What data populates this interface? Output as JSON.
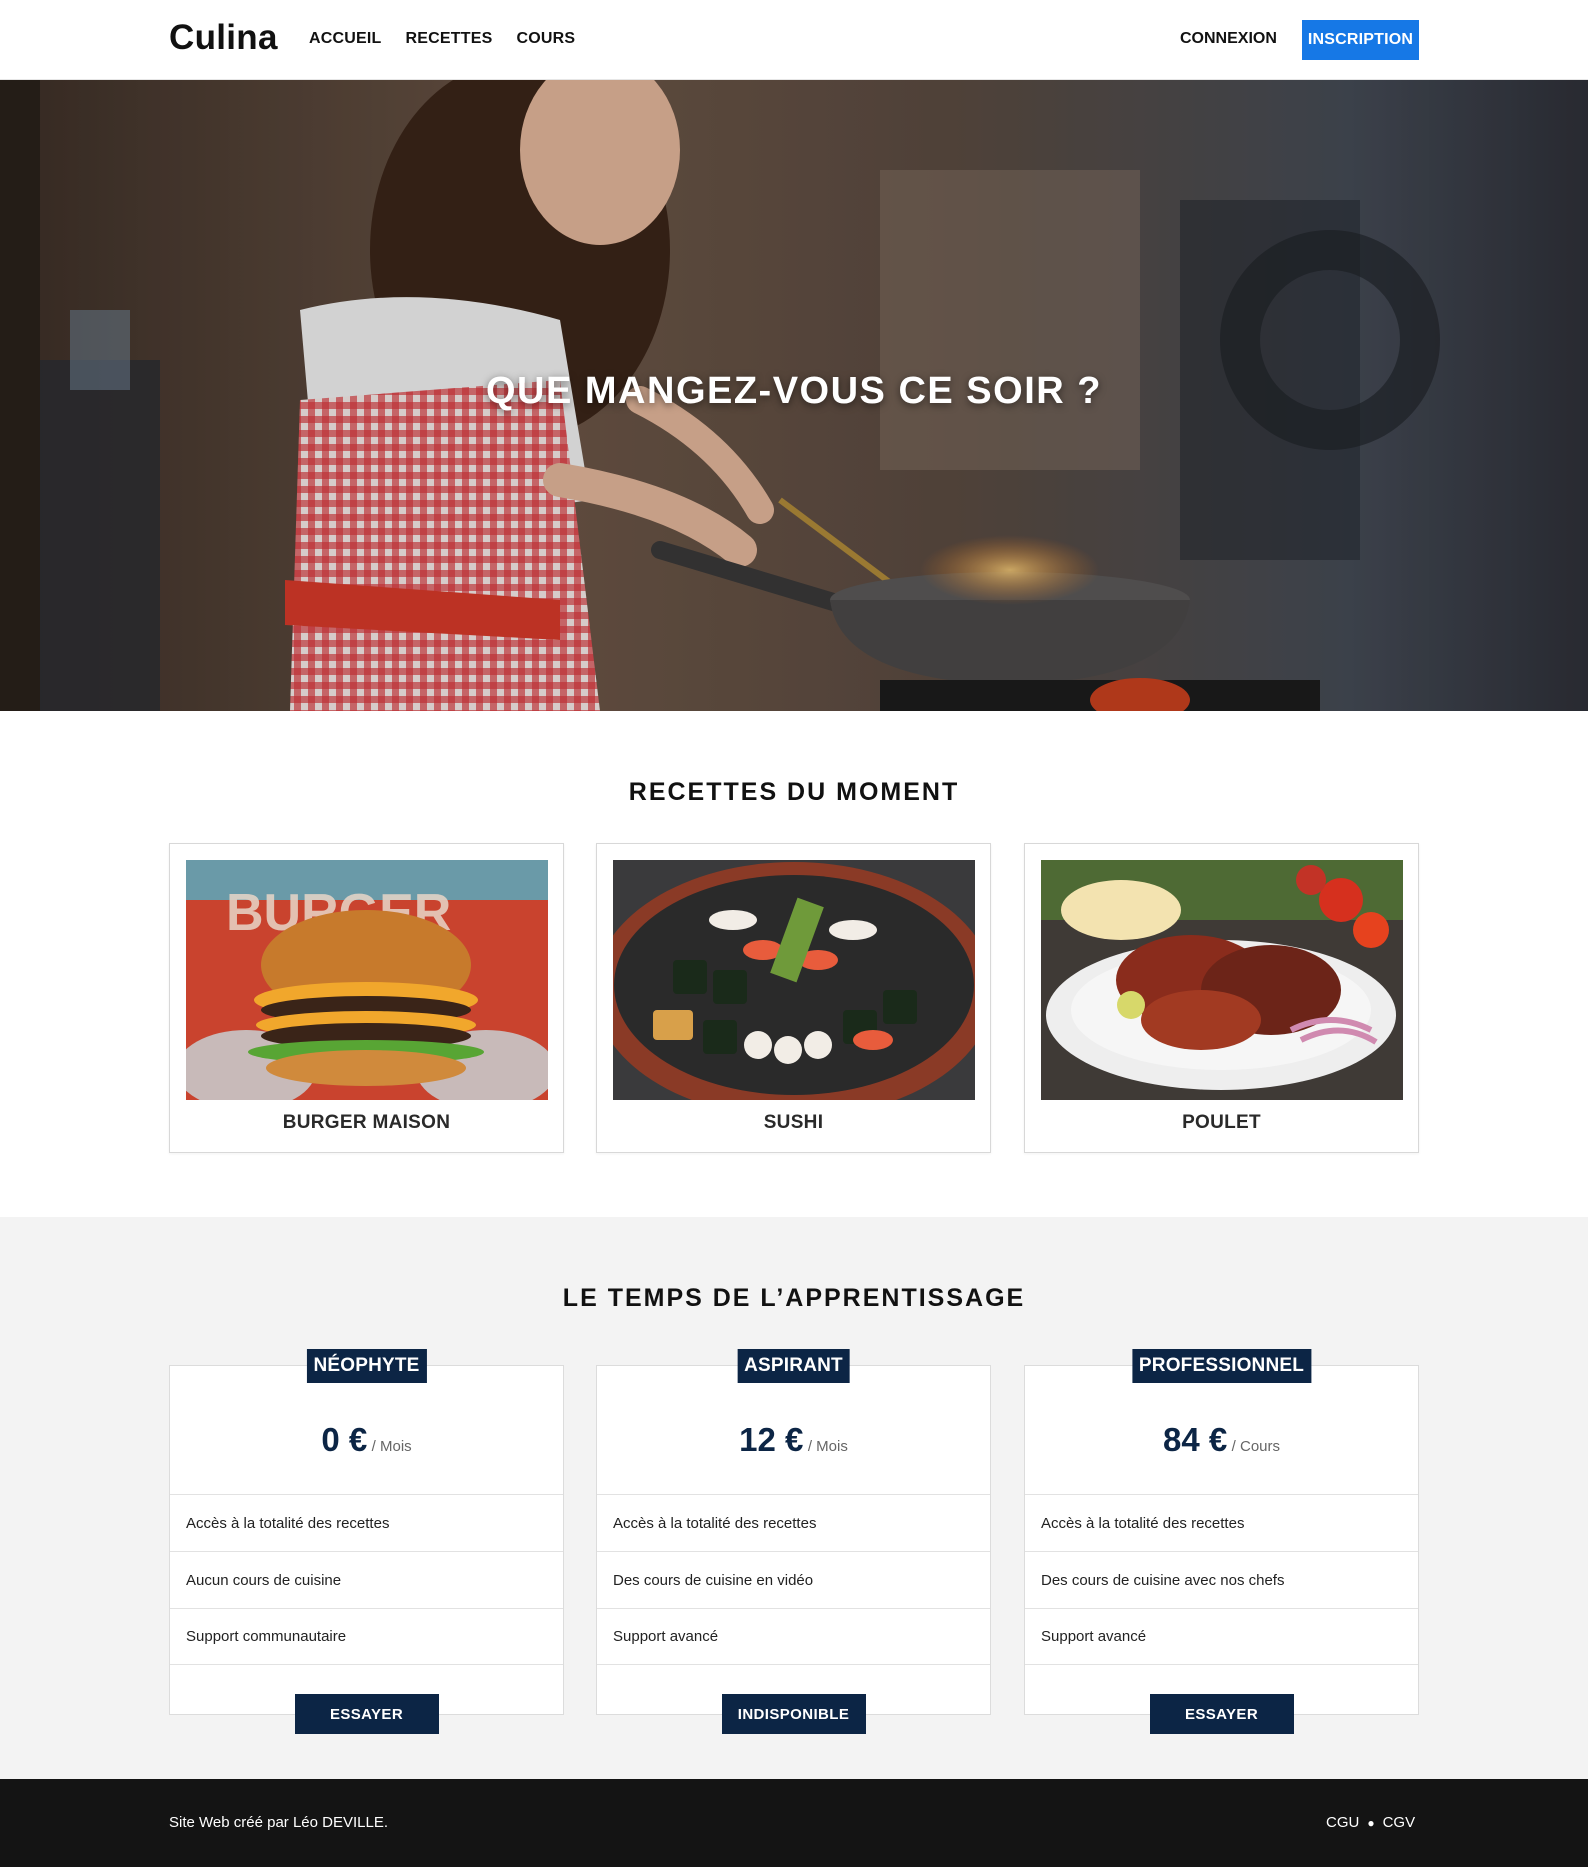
{
  "header": {
    "logo": "Culina",
    "nav": [
      "ACCUEIL",
      "RECETTES",
      "COURS"
    ],
    "login": "CONNEXION",
    "signup": "INSCRIPTION"
  },
  "hero": {
    "title": "QUE MANGEZ-VOUS CE SOIR ?"
  },
  "recipes": {
    "title": "RECETTES DU MOMENT",
    "items": [
      {
        "name": "BURGER MAISON"
      },
      {
        "name": "SUSHI"
      },
      {
        "name": "POULET"
      }
    ]
  },
  "pricing": {
    "title": "LE TEMPS DE L’APPRENTISSAGE",
    "plans": [
      {
        "badge": "NÉOPHYTE",
        "amount": "0 €",
        "period": "/ Mois",
        "features": [
          "Accès à la totalité des recettes",
          "Aucun cours de cuisine",
          "Support communautaire"
        ],
        "button": "ESSAYER"
      },
      {
        "badge": "ASPIRANT",
        "amount": "12 €",
        "period": "/ Mois",
        "features": [
          "Accès à la totalité des recettes",
          "Des cours de cuisine en vidéo",
          "Support avancé"
        ],
        "button": "INDISPONIBLE"
      },
      {
        "badge": "PROFESSIONNEL",
        "amount": "84 €",
        "period": "/ Cours",
        "features": [
          "Accès à la totalité des recettes",
          "Des cours de cuisine avec nos chefs",
          "Support avancé"
        ],
        "button": "ESSAYER"
      }
    ]
  },
  "footer": {
    "credit": "Site Web créé par Léo DEVILLE.",
    "links": [
      "CGU",
      "CGV"
    ],
    "separator": "●"
  },
  "colors": {
    "primary_blue": "#1678e6",
    "navy": "#0c2545",
    "footer_bg": "#141414",
    "section_bg": "#f3f3f3"
  }
}
